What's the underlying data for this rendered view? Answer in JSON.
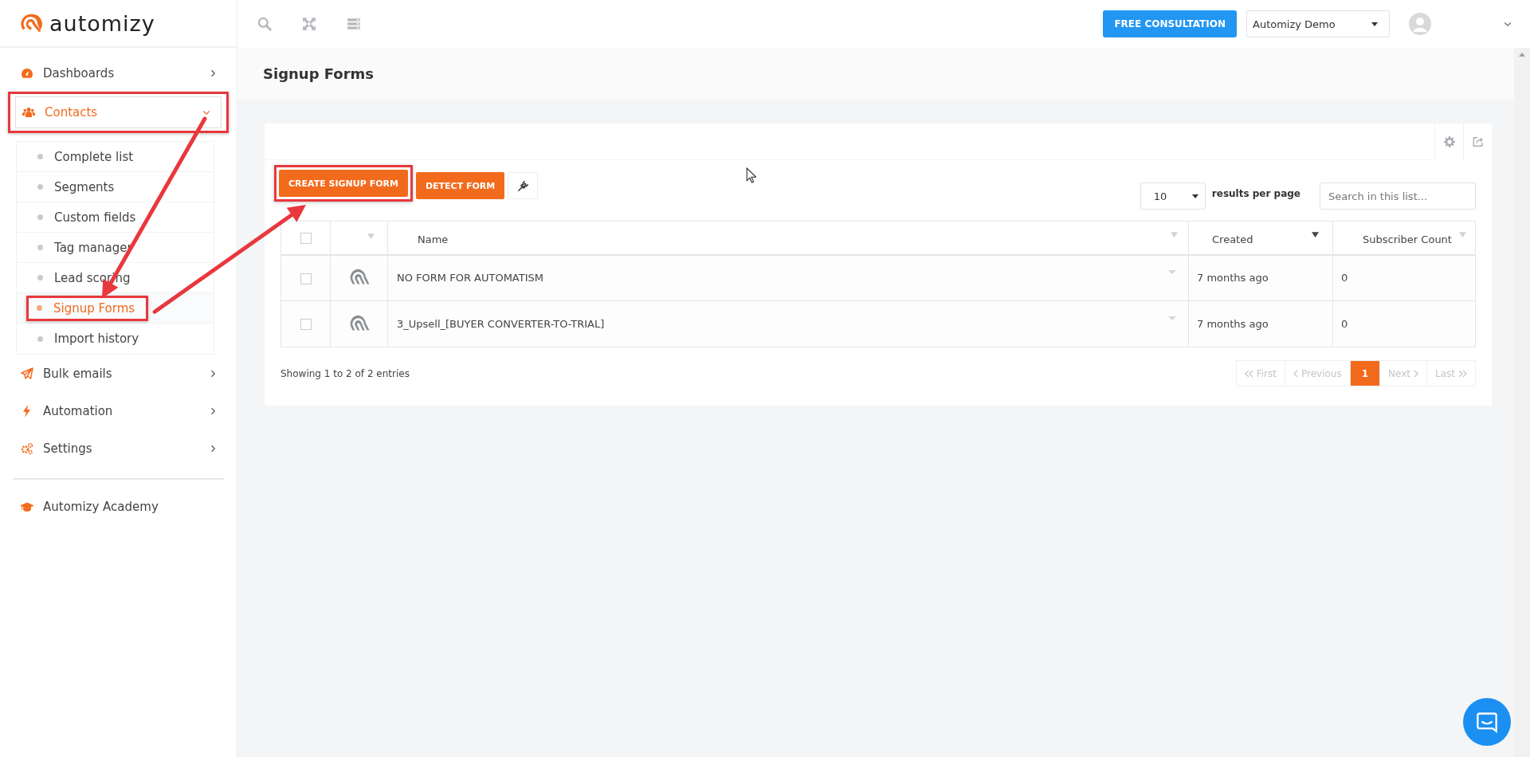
{
  "brand": {
    "name": "automizy"
  },
  "topbar": {
    "consult_button": "FREE CONSULTATION",
    "account_select": {
      "value": "Automizy Demo"
    }
  },
  "sidebar": {
    "items": [
      {
        "label": "Dashboards",
        "kind": "menu",
        "selected": false,
        "expanded": false,
        "highlighted": false
      },
      {
        "label": "Contacts",
        "kind": "menu",
        "selected": true,
        "expanded": true,
        "highlighted": true,
        "children": [
          {
            "label": "Complete list",
            "selected": false,
            "highlighted": false
          },
          {
            "label": "Segments",
            "selected": false,
            "highlighted": false
          },
          {
            "label": "Custom fields",
            "selected": false,
            "highlighted": false
          },
          {
            "label": "Tag manager",
            "selected": false,
            "highlighted": false
          },
          {
            "label": "Lead scoring",
            "selected": false,
            "highlighted": false
          },
          {
            "label": "Signup Forms",
            "selected": true,
            "highlighted": true
          },
          {
            "label": "Import history",
            "selected": false,
            "highlighted": false
          }
        ]
      },
      {
        "label": "Bulk emails",
        "kind": "menu",
        "selected": false,
        "expanded": false,
        "highlighted": false
      },
      {
        "label": "Automation",
        "kind": "menu",
        "selected": false,
        "expanded": false,
        "highlighted": false
      },
      {
        "label": "Settings",
        "kind": "menu",
        "selected": false,
        "expanded": false,
        "highlighted": false
      },
      {
        "label": "Automizy Academy",
        "kind": "link",
        "selected": false,
        "highlighted": false
      }
    ]
  },
  "page_title": "Signup Forms",
  "toolbar": {
    "buttons": [
      {
        "label": "CREATE SIGNUP FORM",
        "kind": "text",
        "highlighted": true
      },
      {
        "label": "DETECT FORM",
        "kind": "text",
        "highlighted": false
      },
      {
        "kind": "plug",
        "highlighted": false
      }
    ]
  },
  "page_size": {
    "value": "10",
    "label": "results per page"
  },
  "search": {
    "placeholder": "Search in this list..."
  },
  "table": {
    "columns": [
      {
        "kind": "checkbox",
        "checked": false
      },
      {
        "kind": "icon",
        "sorted": false
      },
      {
        "kind": "text",
        "label": "Name",
        "sorted": false
      },
      {
        "kind": "text",
        "label": "Created",
        "sorted": true
      },
      {
        "kind": "text",
        "label": "Subscriber Count",
        "sorted": false
      }
    ],
    "rows": [
      {
        "checked": false,
        "name": "NO FORM FOR AUTOMATISM",
        "created": "7 months ago",
        "subscriber_count": "0"
      },
      {
        "checked": false,
        "name": "3_Upsell_[BUYER CONVERTER-TO-TRIAL]",
        "created": "7 months ago",
        "subscriber_count": "0"
      }
    ]
  },
  "entries_info": "Showing 1 to 2 of 2 entries",
  "pagination": [
    {
      "label": "First",
      "kind": "first",
      "selected": false,
      "disabled": true
    },
    {
      "label": "Previous",
      "kind": "previous",
      "selected": false,
      "disabled": true
    },
    {
      "label": "1",
      "kind": "page",
      "selected": true,
      "disabled": false
    },
    {
      "label": "Next",
      "kind": "next",
      "selected": false,
      "disabled": true
    },
    {
      "label": "Last",
      "kind": "last",
      "selected": false,
      "disabled": true
    }
  ]
}
